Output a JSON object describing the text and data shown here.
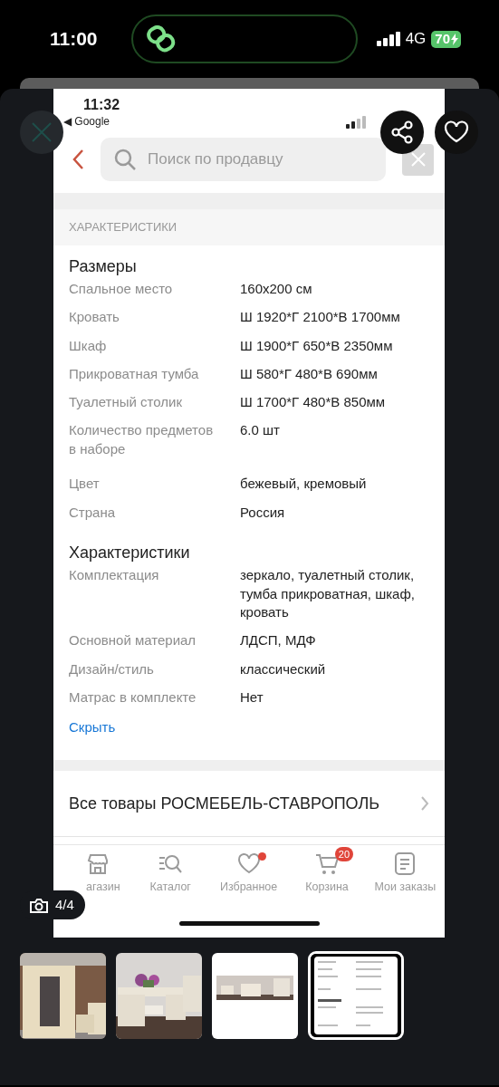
{
  "status_bar": {
    "time": "11:00",
    "network": "4G",
    "battery": "70",
    "charging": true
  },
  "viewer": {
    "counter": "4/4",
    "thumbnails": [
      {
        "kind": "wardrobe",
        "selected": false
      },
      {
        "kind": "vanity",
        "selected": false
      },
      {
        "kind": "room",
        "selected": false
      },
      {
        "kind": "screenshot",
        "selected": true
      }
    ]
  },
  "screenshot": {
    "status_bar": {
      "time": "11:32",
      "back_app": "◀ Google"
    },
    "search": {
      "placeholder": "Поиск по продавцу"
    },
    "section_title": "ХАРАКТЕРИСТИКИ",
    "groups": [
      {
        "title": "Размеры",
        "rows": [
          {
            "label": "Спальное место",
            "value": "160x200 см"
          },
          {
            "label": "Кровать",
            "value": "Ш 1920*Г 2100*В 1700мм"
          },
          {
            "label": "Шкаф",
            "value": "Ш 1900*Г 650*В 2350мм"
          },
          {
            "label": "Прикроватная тумба",
            "value": "Ш 580*Г 480*В 690мм"
          },
          {
            "label": "Туалетный столик",
            "value": "Ш 1700*Г 480*В 850мм"
          },
          {
            "label": "Количество предметов в наборе",
            "value": "6.0 шт"
          }
        ]
      },
      {
        "rows": [
          {
            "label": "Цвет",
            "value": "бежевый, кремовый"
          },
          {
            "label": "Страна",
            "value": "Россия"
          }
        ]
      },
      {
        "title": "Характеристики",
        "rows": [
          {
            "label": "Комплектация",
            "value": "зеркало, туалетный столик, тумба прикроватная, шкаф, кровать"
          },
          {
            "label": "Основной материал",
            "value": "ЛДСП, МДФ"
          },
          {
            "label": "Дизайн/стиль",
            "value": "классический"
          },
          {
            "label": "Матрас в комплекте",
            "value": "Нет"
          }
        ]
      }
    ],
    "collapse_link": "Скрыть",
    "seller_link": "Все товары РОСМЕБЕЛЬ-СТАВРОПОЛЬ",
    "nav": [
      {
        "kind": "store",
        "label": "агазин",
        "dot": false
      },
      {
        "kind": "catalog",
        "label": "Каталог",
        "dot": false
      },
      {
        "kind": "favorites",
        "label": "Избранное",
        "dot": true
      },
      {
        "kind": "cart",
        "label": "Корзина",
        "dot": false,
        "badge": "20"
      },
      {
        "kind": "orders",
        "label": "Мои заказы",
        "dot": false
      }
    ]
  }
}
